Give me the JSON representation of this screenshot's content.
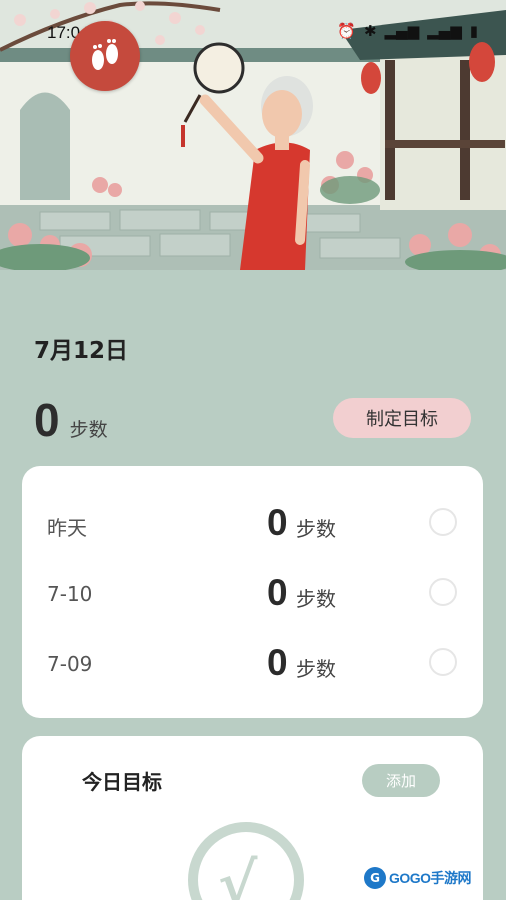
{
  "status_bar": {
    "time": "17:04",
    "icons": [
      "alarm-icon",
      "bluetooth-icon",
      "signal-5g-icon",
      "signal-5g-icon",
      "battery-icon"
    ]
  },
  "header": {
    "logo": "footprints-icon"
  },
  "today": {
    "date": "7月12日",
    "steps": "0",
    "unit": "步数",
    "goal_button": "制定目标"
  },
  "history": [
    {
      "label": "昨天",
      "steps": "0",
      "unit": "步数"
    },
    {
      "label": "7-10",
      "steps": "0",
      "unit": "步数"
    },
    {
      "label": "7-09",
      "steps": "0",
      "unit": "步数"
    }
  ],
  "goal_card": {
    "title": "今日目标",
    "add_button": "添加"
  },
  "watermark": {
    "text": "GOGO手游网"
  },
  "colors": {
    "background": "#b9cdc3",
    "goal_button": "#f2cfd0",
    "add_button": "#b8cdc2",
    "logo": "#c54a3d"
  }
}
